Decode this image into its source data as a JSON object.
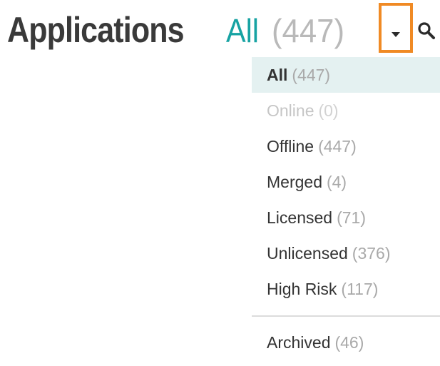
{
  "header": {
    "title": "Applications",
    "filter_name": "All",
    "filter_count": "(447)"
  },
  "icons": {
    "toggle": "caret-down-icon",
    "search": "search-icon"
  },
  "colors": {
    "accent_teal": "#17a3a3",
    "highlight_orange": "#f08a24",
    "active_item_bg": "#e4f1f1"
  },
  "menu": {
    "items": [
      {
        "label": "All",
        "count": "(447)",
        "state": "selected"
      },
      {
        "label": "Online",
        "count": "(0)",
        "state": "disabled"
      },
      {
        "label": "Offline",
        "count": "(447)",
        "state": "normal"
      },
      {
        "label": "Merged",
        "count": "(4)",
        "state": "normal"
      },
      {
        "label": "Licensed",
        "count": "(71)",
        "state": "normal"
      },
      {
        "label": "Unlicensed",
        "count": "(376)",
        "state": "normal"
      },
      {
        "label": "High Risk",
        "count": "(117)",
        "state": "normal"
      }
    ],
    "archived": {
      "label": "Archived",
      "count": "(46)",
      "state": "normal"
    }
  }
}
